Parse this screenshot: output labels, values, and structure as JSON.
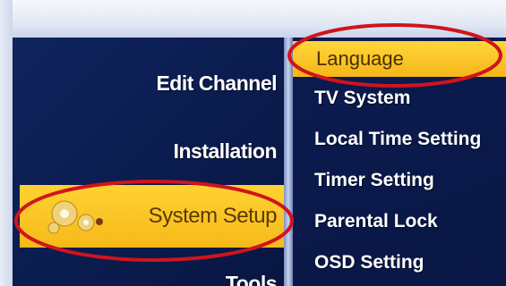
{
  "left_menu": {
    "items": [
      {
        "label": "Edit Channel"
      },
      {
        "label": "Installation"
      },
      {
        "label": "System Setup",
        "selected": true,
        "icon": "gears-icon"
      },
      {
        "label": "Tools"
      }
    ]
  },
  "right_menu": {
    "items": [
      {
        "label": "Language",
        "selected": true
      },
      {
        "label": "TV System"
      },
      {
        "label": "Local Time Setting"
      },
      {
        "label": "Timer Setting"
      },
      {
        "label": "Parental Lock"
      },
      {
        "label": "OSD Setting"
      }
    ]
  },
  "colors": {
    "background": "#0a1a48",
    "highlight": "#ffd233",
    "annotation": "#d0141c"
  }
}
